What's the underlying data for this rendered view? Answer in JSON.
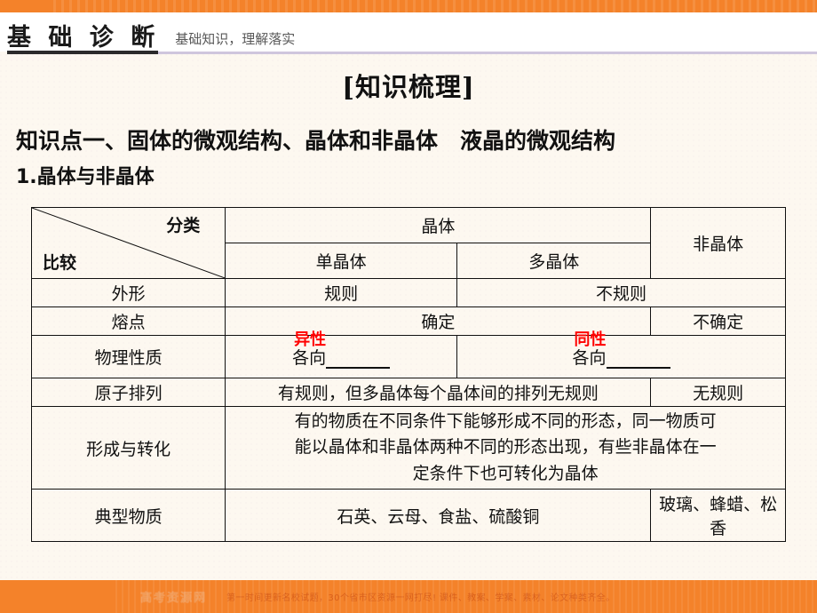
{
  "header": {
    "title": "基 础 诊 断",
    "subtitle": "基础知识，理解落实"
  },
  "colors": {
    "accent_orange": "#f4822a",
    "answer_red": "#ff0000",
    "page_background": "#fdf8f0",
    "rule_purple": "#cfc6dd"
  },
  "content": {
    "knowledge_heading": "[知识梳理]",
    "section_title": "知识点一、固体的微观结构、晶体和非晶体　液晶的微观结构",
    "subsection_title": "1.晶体与非晶体"
  },
  "table": {
    "corner": {
      "top_label": "分类",
      "bottom_label": "比较"
    },
    "group_header": "晶体",
    "columns": [
      "单晶体",
      "多晶体",
      "非晶体"
    ],
    "rows": [
      {
        "label": "外形",
        "cells": [
          "规则",
          "不规则"
        ]
      },
      {
        "label": "熔点",
        "cells": [
          "确定",
          "不确定"
        ]
      },
      {
        "label": "物理性质",
        "prefix_a": "各向",
        "answer_a": "异性",
        "prefix_b": "各向",
        "answer_b": "同性"
      },
      {
        "label": "原子排列",
        "cells": [
          "有规则，但多晶体每个晶体间的排列无规则",
          "无规则"
        ]
      },
      {
        "label": "形成与转化",
        "lines": [
          "有的物质在不同条件下能够形成不同的形态，同一物质可",
          "能以晶体和非晶体两种不同的形态出现，有些非晶体在一",
          "定条件下也可转化为晶体"
        ]
      },
      {
        "label": "典型物质",
        "cells": [
          "石英、云母、食盐、硫酸铜",
          "玻璃、蜂蜡、松香"
        ]
      }
    ]
  },
  "footer": {
    "watermark": "高考资源网",
    "slogan": "第一时间更新名校试题，30个省市区资源一网打尽! 课件、教案、学案、素材、论文种类齐全。"
  }
}
